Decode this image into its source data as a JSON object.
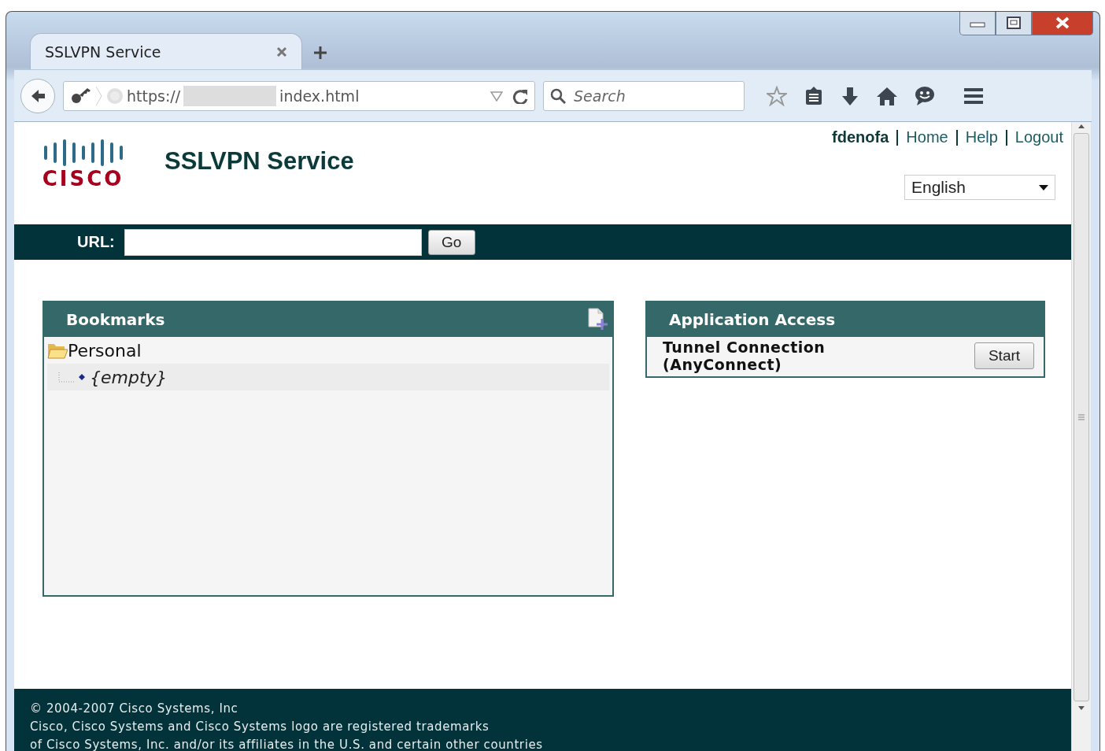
{
  "browser": {
    "tabs": [
      {
        "label": "SSLVPN Service",
        "selected": true
      }
    ],
    "address": {
      "prefix": "https://",
      "suffix": "index.html"
    },
    "search": {
      "placeholder": "Search"
    }
  },
  "header": {
    "logo_text": "CISCO",
    "title": "SSLVPN Service",
    "user": "fdenofa",
    "links": [
      "Home",
      "Help",
      "Logout"
    ],
    "language": "English"
  },
  "url_bar": {
    "label": "URL:",
    "button": "Go"
  },
  "bookmarks": {
    "title": "Bookmarks",
    "tree": [
      {
        "label": "Personal",
        "expanded": true,
        "children": [
          {
            "label": "{empty}"
          }
        ]
      }
    ]
  },
  "application_access": {
    "title": "Application Access",
    "items": [
      {
        "label": "Tunnel Connection (AnyConnect)",
        "button": "Start"
      }
    ]
  },
  "footer": [
    "© 2004-2007 Cisco Systems, Inc",
    "Cisco, Cisco Systems and Cisco Systems logo are registered trademarks",
    "of Cisco Systems, Inc. and/or its affiliates in the U.S. and certain other countries"
  ]
}
